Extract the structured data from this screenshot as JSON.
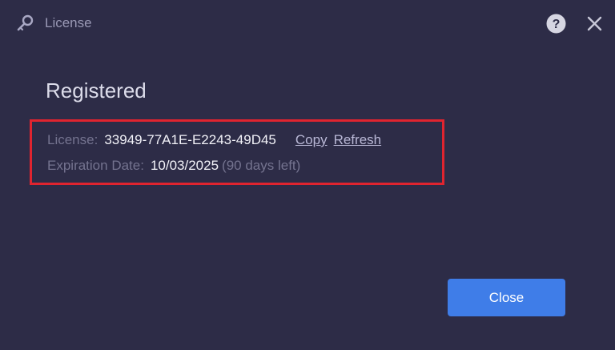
{
  "window": {
    "title": "License",
    "icons": {
      "title": "key-icon",
      "help": "help-icon",
      "close": "close-icon"
    }
  },
  "main": {
    "heading": "Registered",
    "license_label": "License:",
    "license_key": "33949-77A1E-E2243-49D45",
    "copy_label": "Copy",
    "refresh_label": "Refresh",
    "expiration_label": "Expiration Date:",
    "expiration_date": "10/03/2025",
    "days_left": "(90 days left)"
  },
  "footer": {
    "close_label": "Close"
  },
  "colors": {
    "background": "#2d2c47",
    "highlight_border": "#e0242f",
    "accent": "#3f7de8"
  }
}
